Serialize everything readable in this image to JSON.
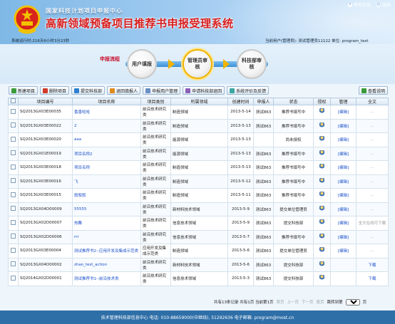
{
  "header": {
    "org_name": "国家科技计划项目申报中心",
    "title": "高新领域预备项目推荐书申报受理系统",
    "links": {
      "help": "帮助信息",
      "logout": "退出"
    },
    "runtime": "系统运行时:216天6小时3分23秒",
    "current_user": "当前用户(管理员): 测试管理员11122    单位: program_test"
  },
  "flow": {
    "label": "申报流程",
    "nodes": [
      "用户填报",
      "管理员审核",
      "科技部审核"
    ]
  },
  "toolbar": {
    "buttons": [
      "新建项目",
      "删除项目",
      "提交科技部",
      "退回填报人",
      "申报用户管理",
      "申请科技部退回",
      "系统评价及反馈"
    ],
    "help": "查看说明"
  },
  "table": {
    "headers": [
      "",
      "项目编号",
      "项目名称",
      "项目类别",
      "所属领域",
      "创建时间",
      "申报人",
      "状态",
      "授权",
      "管理",
      "全文"
    ],
    "rows": [
      {
        "id": "SQ2013GX03E00035",
        "name": "香香哈哈",
        "category": "前沿技术研究类",
        "field": "制造领域",
        "date": "2013-5-14",
        "applicant": "测试863",
        "status": "推荐书填写中",
        "manage": "[编辑]",
        "fulltext": "..."
      },
      {
        "id": "SQ2013GX03E00022",
        "name": "2",
        "category": "前沿技术研究类",
        "field": "制造领域",
        "date": "2013-5-13",
        "applicant": "测试863",
        "status": "推荐书填写中",
        "manage": "[编辑]",
        "fulltext": "..."
      },
      {
        "id": "SQ2013GX03E00020",
        "name": "aaa",
        "category": "前沿技术研究类",
        "field": "能源领域",
        "date": "2013-5-13",
        "applicant": "",
        "status": "尚未授权",
        "manage": "[编辑]",
        "fulltext": "..."
      },
      {
        "id": "SQ2013GX01E00019",
        "name": "项目名称2",
        "category": "前沿技术研究类",
        "field": "能源领域",
        "date": "2013-5-13",
        "applicant": "测试863",
        "status": "推荐书填写中",
        "manage": "[编辑]",
        "fulltext": "..."
      },
      {
        "id": "SQ2013GX03E00018",
        "name": "项目名称",
        "category": "前沿技术研究类",
        "field": "制造领域",
        "date": "2013-5-13",
        "applicant": "测试863",
        "status": "推荐书填写中",
        "manage": "[编辑]",
        "fulltext": "..."
      },
      {
        "id": "SQ2013GX03E00016",
        "name": "飞",
        "category": "前沿技术研究类",
        "field": "制造领域",
        "date": "2013-5-12",
        "applicant": "测试863",
        "status": "推荐书填写中",
        "manage": "[编辑]",
        "fulltext": "..."
      },
      {
        "id": "SQ2013GX03E00015",
        "name": "叙叙叙",
        "category": "前沿技术研究类",
        "field": "制造领域",
        "date": "2013-5-11",
        "applicant": "测试863",
        "status": "推荐书填写中",
        "manage": "[编辑]",
        "fulltext": "..."
      },
      {
        "id": "SQ2013GX04D00009",
        "name": "55555",
        "category": "前沿技术研究类",
        "field": "新材料技术领域",
        "date": "2013-5-9",
        "applicant": "测试863",
        "status": "提交单位管理员",
        "manage": "[编辑]",
        "fulltext": "..."
      },
      {
        "id": "SQ2013GX02D00007",
        "name": "热舞",
        "category": "前沿技术研究类",
        "field": "信息技术领域",
        "date": "2013-5-9",
        "applicant": "测试863",
        "status": "提交科技部",
        "manage": "[编辑]",
        "fulltext": "全文在线可下载"
      },
      {
        "id": "SQ2013GX02D00006",
        "name": "rrr",
        "category": "前沿技术研究类",
        "field": "信息技术领域",
        "date": "2013-5-7",
        "applicant": "测试863",
        "status": "推荐书填写中",
        "manage": "[编辑]",
        "fulltext": "..."
      },
      {
        "id": "SQ2013GX03E00004",
        "name": "测试推荐书2--应用开发及集成示范类",
        "category": "应用开发及集成示范类",
        "field": "制造领域",
        "date": "2013-5-6",
        "applicant": "测试863",
        "status": "提交单位管理员",
        "manage": "[编辑]",
        "fulltext": "..."
      },
      {
        "id": "SQ2013GX04D00002",
        "name": "zhao_test_action",
        "category": "前沿技术研究类",
        "field": "新材料技术领域",
        "date": "2013-5-6",
        "applicant": "测试863",
        "status": "提交科技部",
        "manage": "",
        "fulltext": "下载"
      },
      {
        "id": "SQ2014GX02D00001",
        "name": "测试推荐书1--前沿技术类",
        "category": "前沿技术研究类",
        "field": "信息技术领域",
        "date": "2013-5-3",
        "applicant": "测试863",
        "status": "提交科技部",
        "manage": "",
        "fulltext": "下载"
      }
    ]
  },
  "pager": {
    "summary": "共有13条记录 共有1页 当前第1页",
    "first": "首页",
    "prev": "上一页",
    "next": "下一页",
    "last": "尾页",
    "jump": "跳转到第",
    "page_unit": "页",
    "page_value": "1"
  },
  "footer": "技术管理科技部信息中心  电话: 010-88659000(中继线), 51292636  电子邮箱: program@most.cn",
  "colors": {
    "accent": "#3b8fd6",
    "title_red": "#d81d1d",
    "footer": "#2f6fa8"
  }
}
